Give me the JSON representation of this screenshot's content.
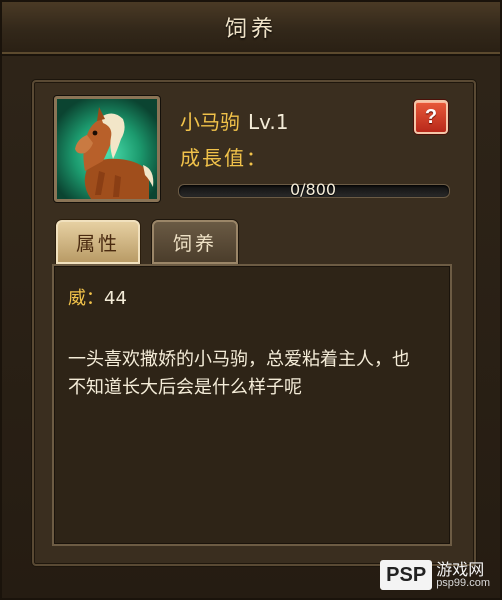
{
  "window": {
    "title": "饲养"
  },
  "pet": {
    "name": "小马驹",
    "level": "Lv.1",
    "growth_label": "成長值：",
    "growth_progress_text": "0/800",
    "growth_fraction": 0.0,
    "portrait_icon": "foal-icon"
  },
  "help_button": {
    "label": "?"
  },
  "tabs": [
    {
      "label": "属性",
      "active": true
    },
    {
      "label": "饲养",
      "active": false
    }
  ],
  "stats": {
    "label": "威：",
    "value": "44"
  },
  "description": "一头喜欢撒娇的小马驹，总爱粘着主人，也不知道长大后会是什么样子呢",
  "watermark": {
    "logo_text": "PSP",
    "title": "游戏网",
    "site": "psp99.com"
  },
  "colors": {
    "accent_gold": "#f1c24a",
    "text_light": "#f4ecd8",
    "help_red": "#d0381f",
    "progress_green": "#5cc034"
  }
}
